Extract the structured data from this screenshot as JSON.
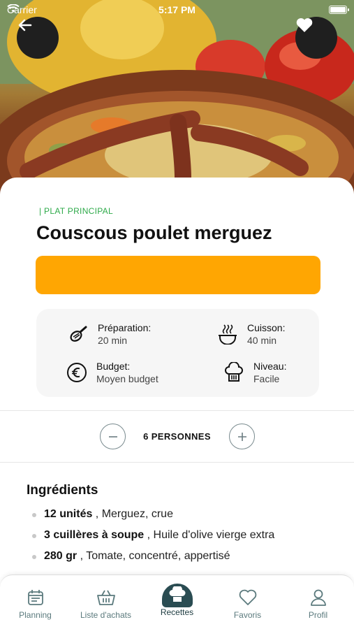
{
  "status_bar": {
    "carrier": "Carrier",
    "time": "5:17 PM"
  },
  "hero": {
    "back_icon": "arrow-left-icon",
    "favorite_icon": "heart-icon"
  },
  "recipe": {
    "category": "| PLAT PRINCIPAL",
    "title": "Couscous poulet merguez",
    "accent_color": "#ffa602",
    "info": [
      {
        "icon": "whisk-icon",
        "label": "Préparation:",
        "value": "20 min"
      },
      {
        "icon": "pot-icon",
        "label": "Cuisson:",
        "value": "40 min"
      },
      {
        "icon": "euro-icon",
        "label": "Budget:",
        "value": "Moyen budget"
      },
      {
        "icon": "chef-hat-icon",
        "label": "Niveau:",
        "value": "Facile"
      }
    ]
  },
  "servings": {
    "label": "6 PERSONNES",
    "minus_icon": "minus-icon",
    "plus_icon": "plus-icon"
  },
  "ingredients": {
    "title": "Ingrédients",
    "items": [
      {
        "qty": "12 unités",
        "name": " , Merguez, crue"
      },
      {
        "qty": "3 cuillères à soupe",
        "name": " , Huile d'olive vierge extra"
      },
      {
        "qty": "280 gr",
        "name": " , Tomate, concentré, appertisé"
      }
    ]
  },
  "tabbar": {
    "tabs": [
      {
        "label": "Planning",
        "icon": "calendar-icon"
      },
      {
        "label": "Liste d'achats",
        "icon": "basket-icon"
      },
      {
        "label": "Recettes",
        "icon": "chef-hat-icon",
        "active": true
      },
      {
        "label": "Favoris",
        "icon": "heart-outline-icon"
      },
      {
        "label": "Profil",
        "icon": "user-icon"
      }
    ]
  }
}
